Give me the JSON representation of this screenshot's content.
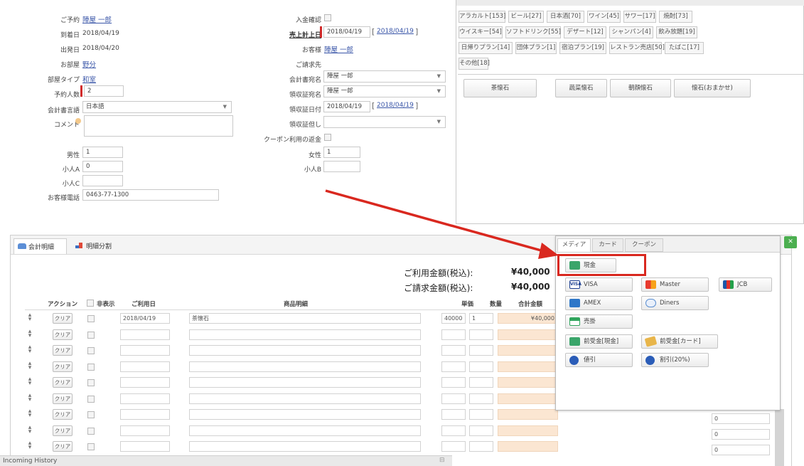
{
  "reservation": {
    "booker_label": "ご予約",
    "booker_name": "陣屋 一郎",
    "arrival_label": "到着日",
    "arrival_date": "2018/04/19",
    "departure_label": "出発日",
    "departure_date": "2018/04/20",
    "room_label": "お部屋",
    "room_name": "野分",
    "room_type_label": "部屋タイプ",
    "room_type": "和室",
    "guests_label": "予約人数",
    "guests": "2",
    "language_label": "会計書言語",
    "language": "日本語",
    "comment_label": "コメント",
    "male_label": "男性",
    "male": "1",
    "child_a_label": "小人A",
    "child_a": "0",
    "child_b_label": "小人B",
    "child_c_label": "小人C",
    "phone_label": "お客様電話",
    "phone": "0463-77-1300"
  },
  "billing": {
    "entry_confirm_label": "入金確認",
    "sales_date_label": "売上計上日",
    "sales_date": "2018/04/19",
    "sales_date_link": "2018/04/19",
    "customer_label": "お客様",
    "customer_name": "陣屋 一郎",
    "bill_to_label": "ご請求先",
    "account_name_label": "会計書宛名",
    "account_name": "陣屋 一郎",
    "receipt_name_label": "領収証宛名",
    "receipt_name": "陣屋 一郎",
    "receipt_date_label": "領収証日付",
    "receipt_date": "2018/04/19",
    "receipt_date_link": "2018/04/19",
    "receipt_note_label": "領収証但し",
    "coupon_label": "クーポン利用の返金",
    "female_label": "女性",
    "female": "1"
  },
  "categories": {
    "row1": [
      "アラカルト[153]",
      "ビール[27]",
      "日本酒[70]",
      "ワイン[45]",
      "サワー[17]",
      "焼酎[73]"
    ],
    "row2": [
      "ウイスキー[54]",
      "ソフトドリンク[55]",
      "デザート[12]",
      "シャンパン[4]",
      "飲み放題[19]"
    ],
    "row3": [
      "日帰りプラン[14]",
      "団体プラン[1]",
      "宿泊プラン[19]",
      "レストラン売店[50]",
      "たばこ[17]"
    ],
    "row4": [
      "その他[18]"
    ],
    "menu_items": [
      "茶懐石",
      "蔬菜懐石",
      "朝顔懐石",
      "懐石(おまかせ)"
    ]
  },
  "detail": {
    "tab_detail": "会計明細",
    "tab_split": "明細分割",
    "usage_amount_label": "ご利用金額(税込):",
    "usage_amount": "¥40,000",
    "invoice_amount_label": "ご請求金額(税込):",
    "invoice_amount": "¥40,000",
    "headers": {
      "action": "アクション",
      "hide": "非表示",
      "date": "ご利用日",
      "item": "商品明細",
      "unit_price": "単価",
      "qty": "数量",
      "total": "合計金額"
    },
    "clear_label": "クリア",
    "rows": [
      {
        "date": "2018/04/19",
        "item": "茶懐石",
        "price": "40000",
        "qty": "1",
        "total": "¥40,000"
      },
      {
        "date": "",
        "item": "",
        "price": "",
        "qty": "",
        "total": ""
      },
      {
        "date": "",
        "item": "",
        "price": "",
        "qty": "",
        "total": ""
      },
      {
        "date": "",
        "item": "",
        "price": "",
        "qty": "",
        "total": ""
      },
      {
        "date": "",
        "item": "",
        "price": "",
        "qty": "",
        "total": ""
      },
      {
        "date": "",
        "item": "",
        "price": "",
        "qty": "",
        "total": ""
      },
      {
        "date": "",
        "item": "",
        "price": "",
        "qty": "",
        "total": ""
      },
      {
        "date": "",
        "item": "",
        "price": "",
        "qty": "",
        "total": ""
      },
      {
        "date": "",
        "item": "",
        "price": "",
        "qty": "",
        "total": ""
      }
    ],
    "zero_values": [
      "0",
      "0",
      "0"
    ],
    "footer_label": "Incoming History"
  },
  "payment": {
    "tabs": [
      "メディア",
      "カード",
      "クーポン"
    ],
    "cash": "現金",
    "visa": "VISA",
    "master": "Master",
    "jcb": "JCB",
    "amex": "AMEX",
    "diners": "Diners",
    "credit": "売掛",
    "advance_cash": "前受金[現金]",
    "advance_card": "前受金[カード]",
    "discount": "値引",
    "discount_pct": "割引(20%)"
  },
  "colors": {
    "highlight": "#d9281f",
    "arrow": "#d9281f",
    "link": "#3a56a8",
    "total_bg": "#fbe6d2"
  }
}
